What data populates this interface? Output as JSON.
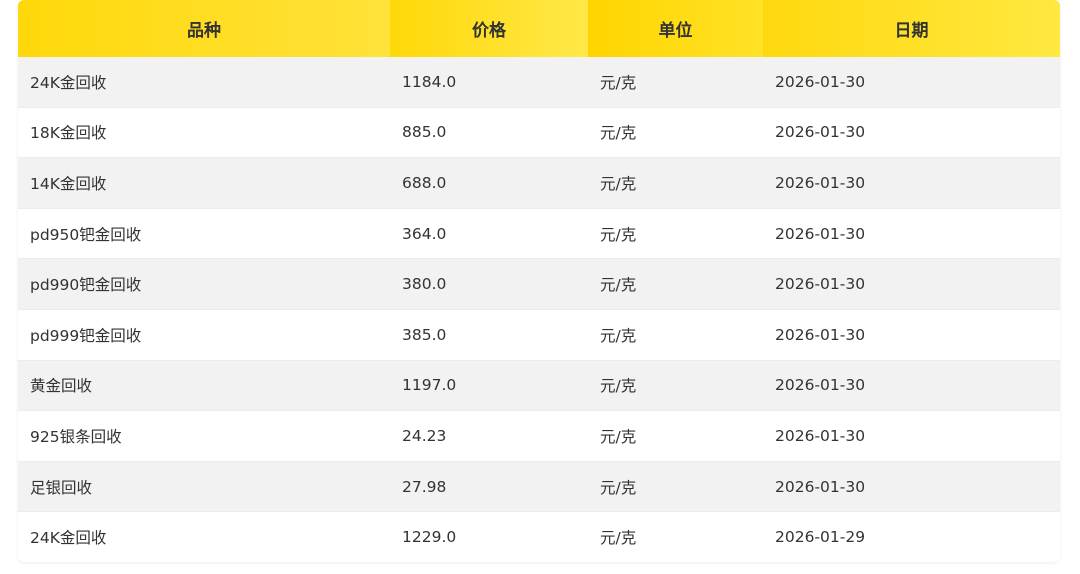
{
  "table": {
    "headers": {
      "variety": "品种",
      "price": "价格",
      "unit": "单位",
      "date": "日期"
    },
    "rows": [
      {
        "variety": "24K金回收",
        "price": "1184.0",
        "unit": "元/克",
        "date": "2026-01-30"
      },
      {
        "variety": "18K金回收",
        "price": "885.0",
        "unit": "元/克",
        "date": "2026-01-30"
      },
      {
        "variety": "14K金回收",
        "price": "688.0",
        "unit": "元/克",
        "date": "2026-01-30"
      },
      {
        "variety": "pd950钯金回收",
        "price": "364.0",
        "unit": "元/克",
        "date": "2026-01-30"
      },
      {
        "variety": "pd990钯金回收",
        "price": "380.0",
        "unit": "元/克",
        "date": "2026-01-30"
      },
      {
        "variety": "pd999钯金回收",
        "price": "385.0",
        "unit": "元/克",
        "date": "2026-01-30"
      },
      {
        "variety": "黄金回收",
        "price": "1197.0",
        "unit": "元/克",
        "date": "2026-01-30"
      },
      {
        "variety": "925银条回收",
        "price": "24.23",
        "unit": "元/克",
        "date": "2026-01-30"
      },
      {
        "variety": "足银回收",
        "price": "27.98",
        "unit": "元/克",
        "date": "2026-01-30"
      },
      {
        "variety": "24K金回收",
        "price": "1229.0",
        "unit": "元/克",
        "date": "2026-01-29"
      }
    ]
  },
  "colors": {
    "header_yellow": "#ffd80a",
    "row_stripe": "#f2f2f2",
    "text": "#333333"
  }
}
